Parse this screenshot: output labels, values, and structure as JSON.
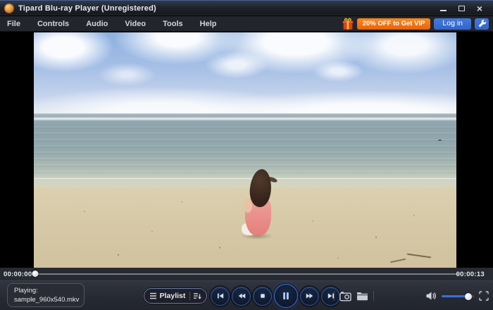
{
  "titlebar": {
    "title": "Tipard Blu-ray Player (Unregistered)"
  },
  "menu": {
    "items": [
      "File",
      "Controls",
      "Audio",
      "Video",
      "Tools",
      "Help"
    ]
  },
  "promo": {
    "vip_button": "20% OFF to Get VIP",
    "login_button": "Log in"
  },
  "transport": {
    "elapsed": "00:00:00",
    "duration": "00:00:13",
    "progress_pct": 1
  },
  "now_playing": {
    "label": "Playing:",
    "filename": "sample_960x540.mkv"
  },
  "playback": {
    "playlist_label": "Playlist"
  },
  "volume": {
    "level_pct": 83
  },
  "icons": {
    "close": "×"
  },
  "colors": {
    "accent_blue": "#3b6fd6",
    "accent_orange": "#f2731a",
    "titlebar_top_edge": "#44608e"
  }
}
